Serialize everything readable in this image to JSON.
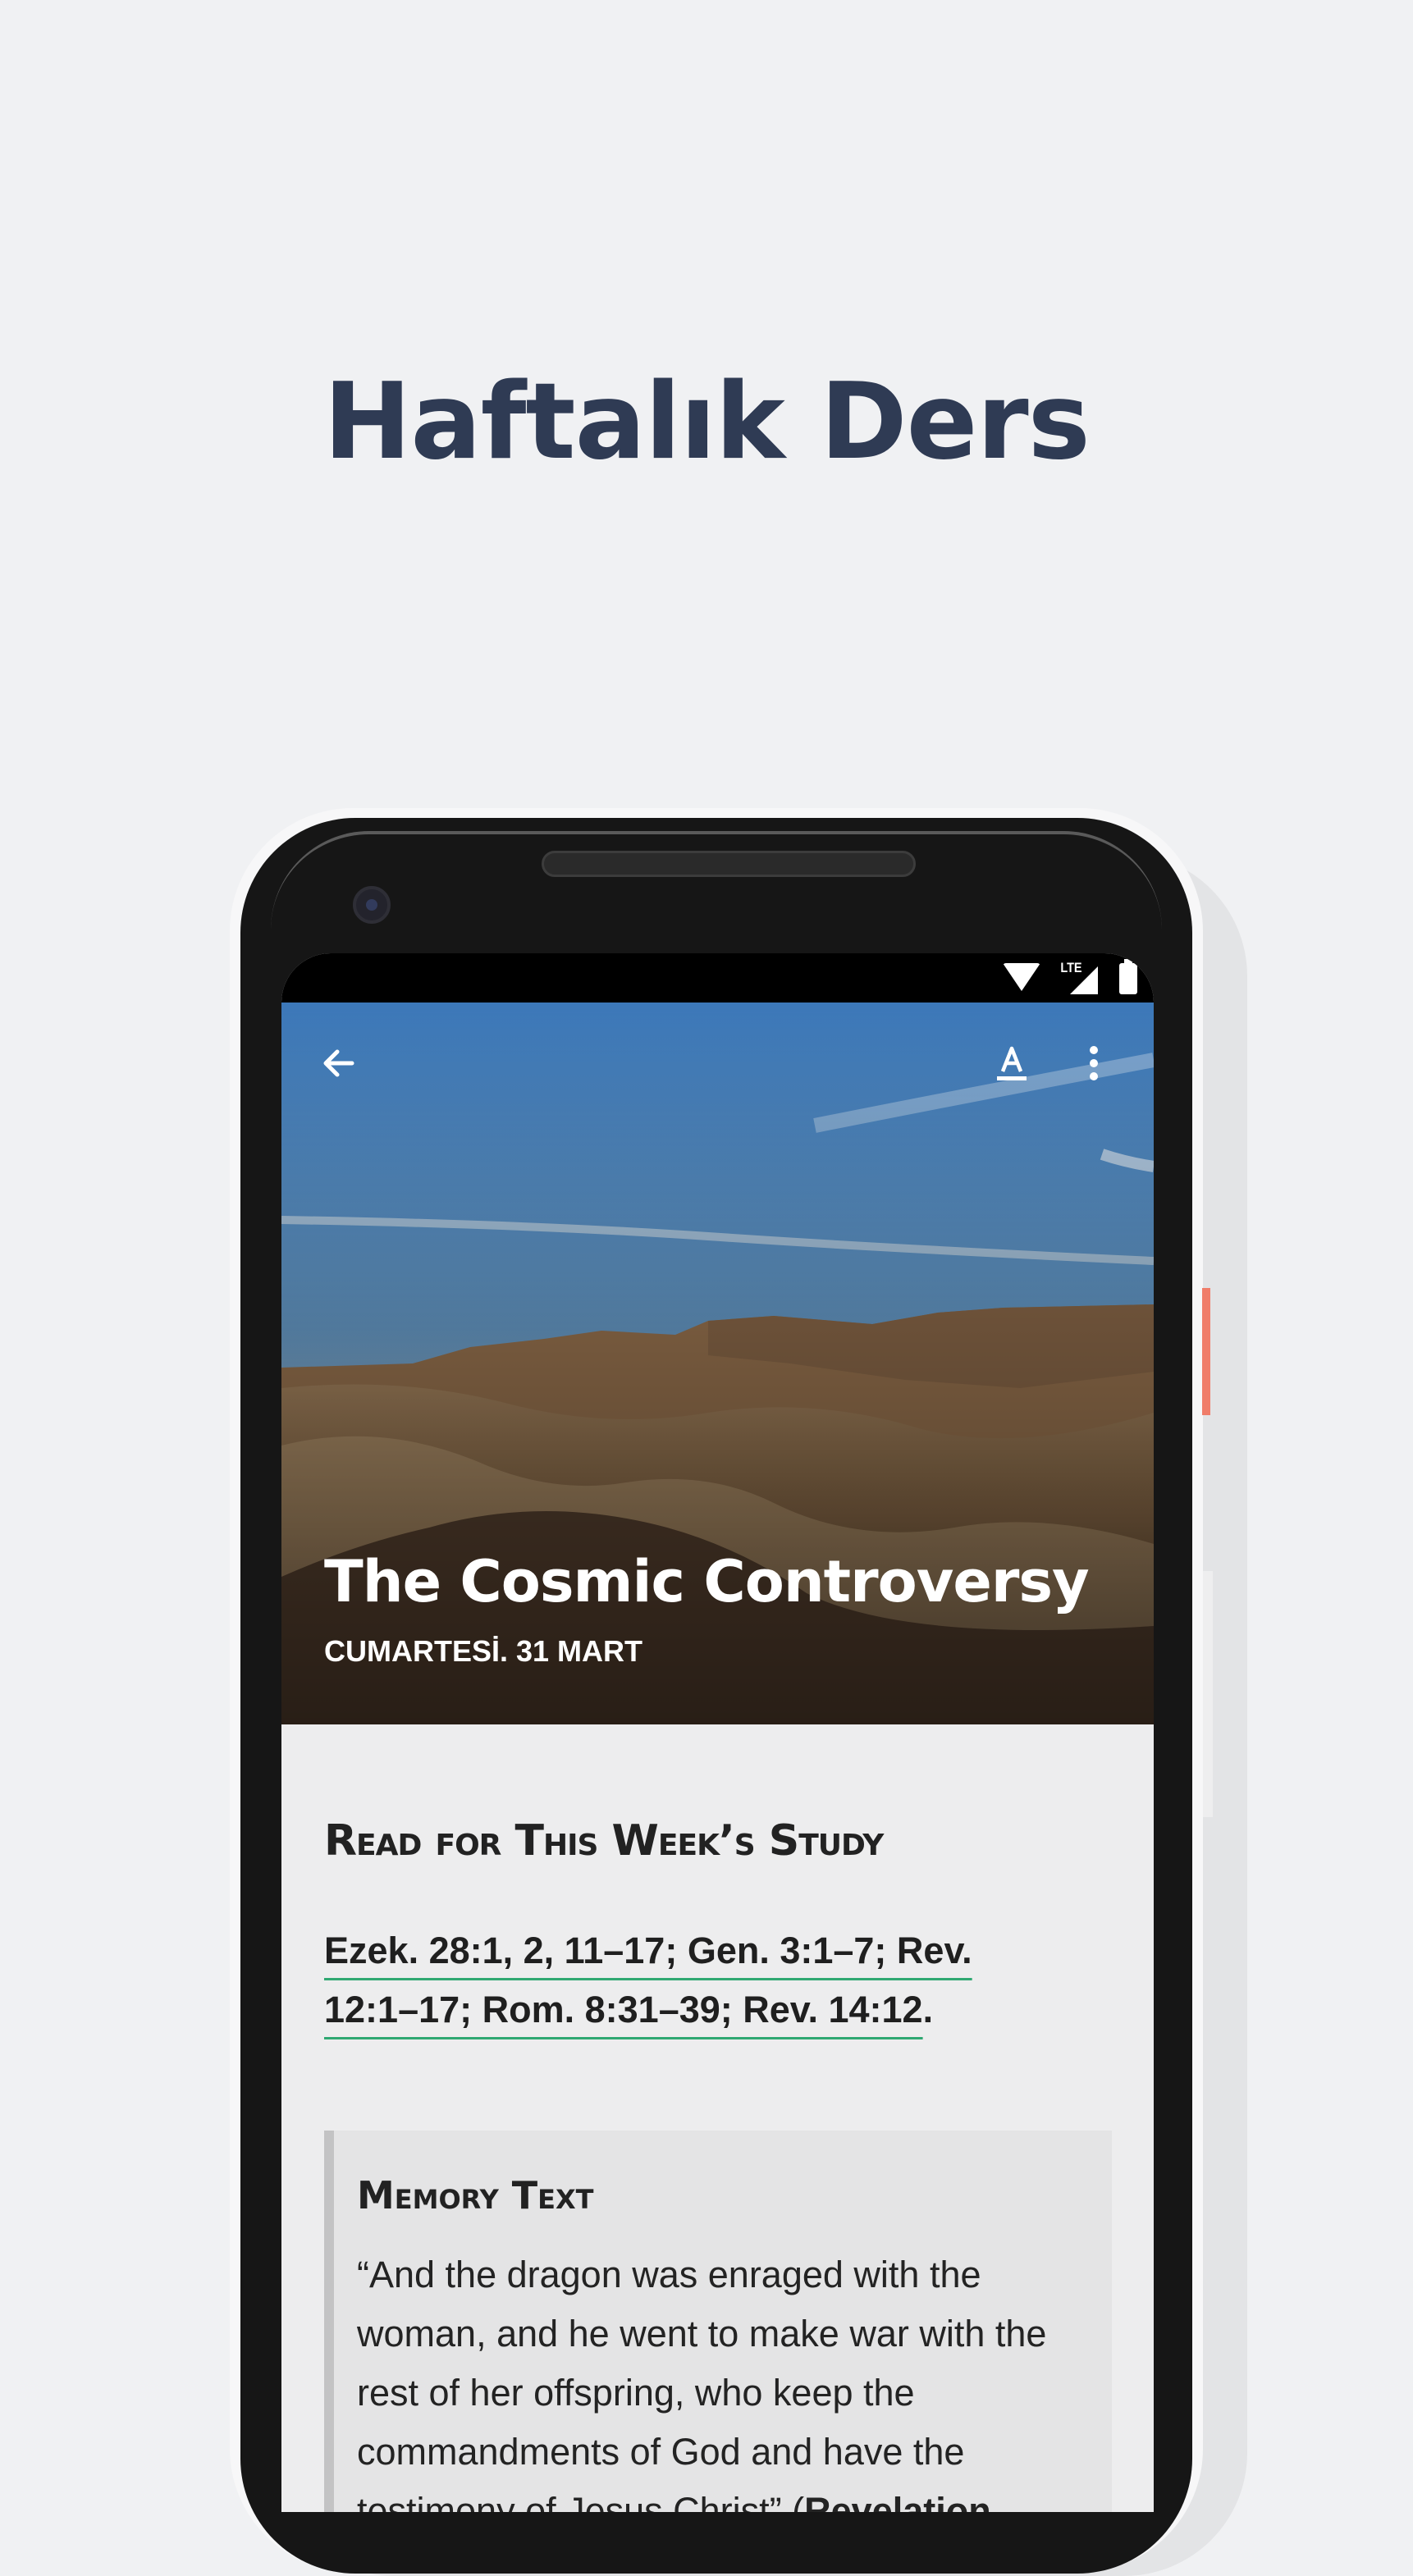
{
  "page": {
    "headline": "Haftalık Ders"
  },
  "status_bar": {
    "network": "LTE"
  },
  "lesson": {
    "title": "The Cosmic Controversy",
    "date": "CUMARTESİ. 31 MART"
  },
  "toolbar": {
    "back_icon": "arrow-left-icon",
    "font_icon": "text-format-icon",
    "more_icon": "more-vertical-icon"
  },
  "content": {
    "section_heading": "Read for This Week’s Study",
    "references_line1": "Ezek. 28:1, 2, 11–17; Gen. 3:1–7; Rev.",
    "references_line2": "12:1–17; Rom. 8:31–39; Rev. 14:12",
    "references_end": ".",
    "memory_heading": "Memory Text",
    "memory_body": "“And the dragon was enraged with the woman, and he went to make war with the rest of her offspring, who keep the commandments of God and have the testimony of Jesus Christ” (",
    "memory_citation": "Revelation"
  },
  "colors": {
    "background": "#f0f1f3",
    "headline": "#2f3b54",
    "link_underline": "#2fa872",
    "side_button_accent": "#f07d6a"
  }
}
